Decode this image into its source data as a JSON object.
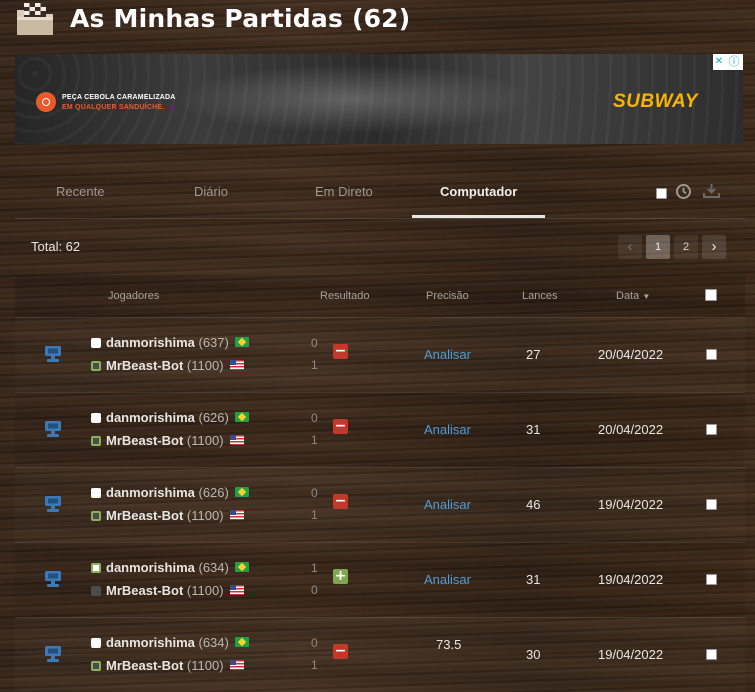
{
  "header": {
    "title": "As Minhas Partidas (62)"
  },
  "ad": {
    "line1": "PEÇA CEBOLA CARAMELIZADA",
    "line2": "EM QUALQUER SANDUÍCHE.",
    "brand_a": "SUBWAY",
    "brand_b": "",
    "choices_icon": "ⓘ",
    "close_icon": "✕"
  },
  "tabs": [
    {
      "label": "Recente"
    },
    {
      "label": "Diário"
    },
    {
      "label": "Em Direto"
    },
    {
      "label": "Computador",
      "active": true
    }
  ],
  "total": "Total: 62",
  "pagination": {
    "prev": "‹",
    "pages": [
      "1",
      "2"
    ],
    "current": "1",
    "next": "›"
  },
  "columns": {
    "players": "Jogadores",
    "result": "Resultado",
    "accuracy": "Precisão",
    "moves": "Lances",
    "date": "Data"
  },
  "games": [
    {
      "white": {
        "name": "danmorishima",
        "rating": "(637)",
        "flag": "br"
      },
      "black": {
        "name": "MrBeast-Bot",
        "rating": "(1100)",
        "flag": "us"
      },
      "score_white": "0",
      "score_black": "1",
      "result": "loss",
      "result_icon": "−",
      "accuracy": "Analisar",
      "moves": "27",
      "date": "20/04/2022"
    },
    {
      "white": {
        "name": "danmorishima",
        "rating": "(626)",
        "flag": "br"
      },
      "black": {
        "name": "MrBeast-Bot",
        "rating": "(1100)",
        "flag": "us"
      },
      "score_white": "0",
      "score_black": "1",
      "result": "loss",
      "result_icon": "−",
      "accuracy": "Analisar",
      "moves": "31",
      "date": "20/04/2022"
    },
    {
      "white": {
        "name": "danmorishima",
        "rating": "(626)",
        "flag": "br"
      },
      "black": {
        "name": "MrBeast-Bot",
        "rating": "(1100)",
        "flag": "us"
      },
      "score_white": "0",
      "score_black": "1",
      "result": "loss",
      "result_icon": "−",
      "accuracy": "Analisar",
      "moves": "46",
      "date": "19/04/2022"
    },
    {
      "white": {
        "name": "danmorishima",
        "rating": "(634)",
        "flag": "br"
      },
      "black": {
        "name": "MrBeast-Bot",
        "rating": "(1100)",
        "flag": "us"
      },
      "score_white": "1",
      "score_black": "0",
      "result": "win",
      "result_icon": "+",
      "accuracy": "Analisar",
      "moves": "31",
      "date": "19/04/2022"
    },
    {
      "white": {
        "name": "danmorishima",
        "rating": "(634)",
        "flag": "br"
      },
      "black": {
        "name": "MrBeast-Bot",
        "rating": "(1100)",
        "flag": "us"
      },
      "score_white": "0",
      "score_black": "1",
      "result": "loss",
      "result_icon": "−",
      "accuracy": "73.5",
      "moves": "30",
      "date": "19/04/2022"
    }
  ],
  "colors": {
    "link": "#4f9bd6",
    "loss": "#c0392b",
    "win": "#7fa650",
    "subway_yellow": "#f7b500",
    "ad_orange": "#e85a2a"
  },
  "icons": {
    "folder": "folder-icon",
    "computer": "computer-icon",
    "clock": "clock-icon",
    "download": "download-icon",
    "sort": "sort-down-icon"
  }
}
